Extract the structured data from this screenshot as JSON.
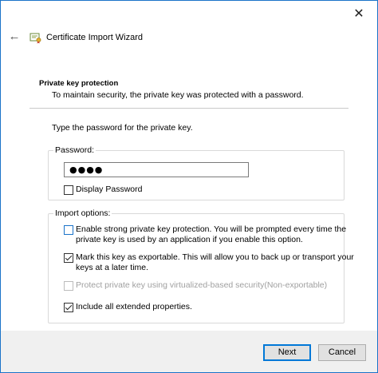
{
  "window": {
    "close_glyph": "✕",
    "back_glyph": "←",
    "title": "Certificate Import Wizard",
    "accent_color": "#0078d7"
  },
  "section": {
    "title": "Private key protection",
    "description": "To maintain security, the private key was protected with a password."
  },
  "prompt": "Type the password for the private key.",
  "password_group": {
    "label": "Password:",
    "value": "●●●●",
    "display_password": {
      "label": "Display Password",
      "checked": false
    }
  },
  "options_group": {
    "label": "Import options:",
    "items": [
      {
        "line1": "Enable strong private key protection. You will be prompted every time the",
        "line2": "private key is used by an application if you enable this option.",
        "checked": false,
        "enabled": true
      },
      {
        "line1": "Mark this key as exportable. This will allow you to back up or transport your",
        "line2": "keys at a later time.",
        "checked": true,
        "enabled": true
      },
      {
        "line1": "Protect private key using virtualized-based security(Non-exportable)",
        "checked": false,
        "enabled": false
      },
      {
        "line1": "Include all extended properties.",
        "checked": true,
        "enabled": true
      }
    ]
  },
  "buttons": {
    "next": "Next",
    "cancel": "Cancel"
  }
}
